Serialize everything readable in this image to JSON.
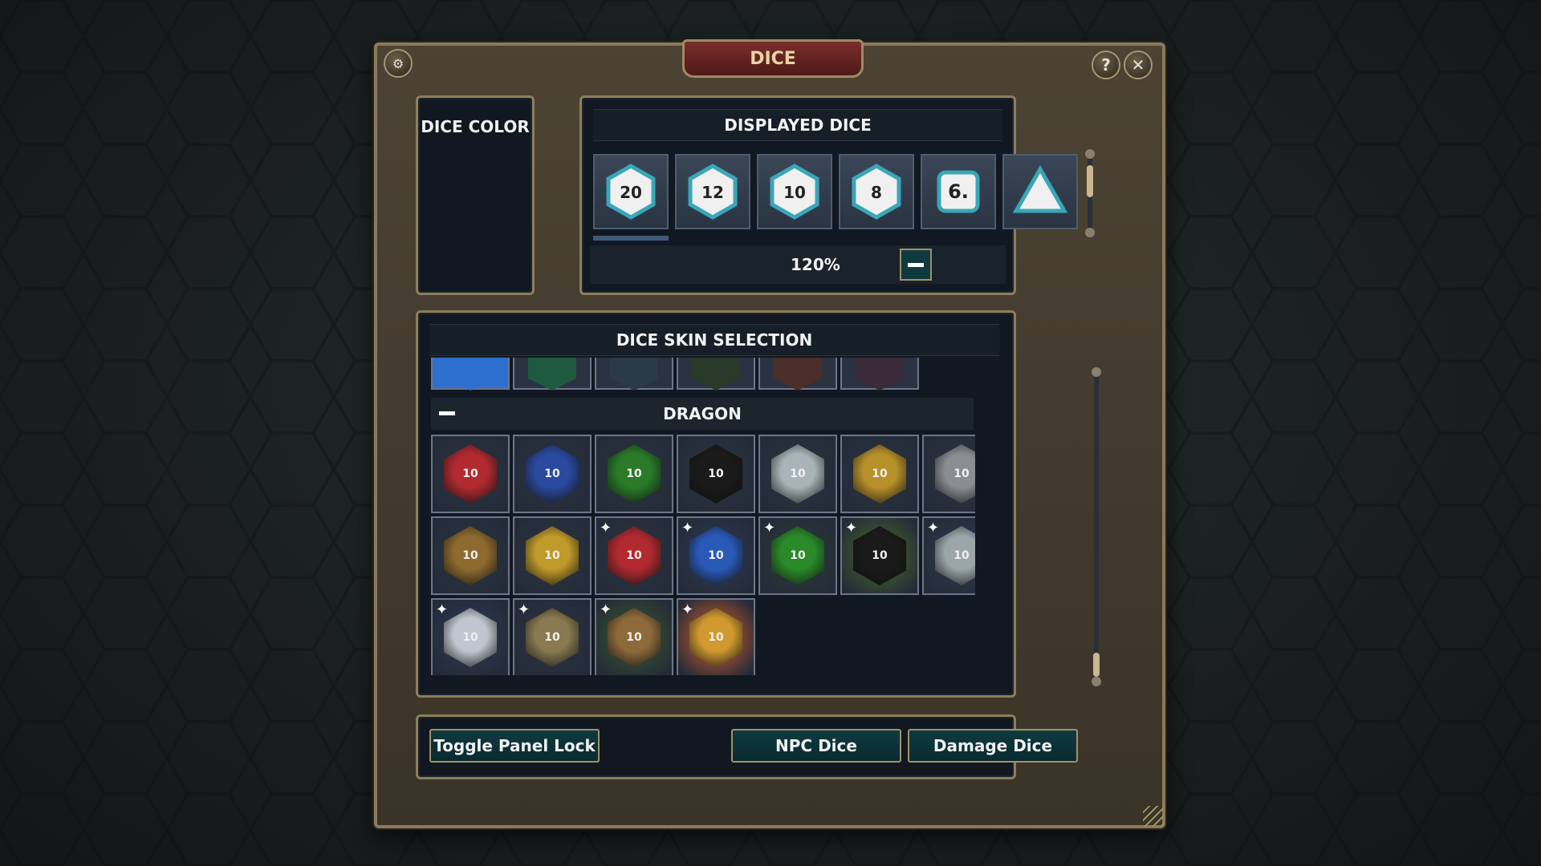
{
  "window": {
    "title": "DICE"
  },
  "dice_color": {
    "heading": "DICE COLOR"
  },
  "displayed_dice": {
    "heading": "DISPLAYED DICE",
    "dice": [
      {
        "label": "20",
        "icon": "d20-icon"
      },
      {
        "label": "12",
        "icon": "d12-icon"
      },
      {
        "label": "10",
        "icon": "d10-icon"
      },
      {
        "label": "8",
        "icon": "d8-icon"
      },
      {
        "label": "6.",
        "icon": "d6-icon"
      },
      {
        "label": "",
        "icon": "d4-icon"
      }
    ],
    "scale": "120%"
  },
  "skin_selection": {
    "heading": "DICE SKIN SELECTION",
    "group": "DRAGON",
    "top_row_colors": [
      "#2f6fd0",
      "#1f5a40",
      "#2a3a48",
      "#2a3a2a",
      "#4a2e2a",
      "#3a2a3a"
    ],
    "dragon_dice": [
      {
        "color": "#b02a30",
        "effect": false,
        "bg": "#2b3242",
        "label": "10"
      },
      {
        "color": "#2a4aa0",
        "effect": false,
        "bg": "#2b3242",
        "label": "10"
      },
      {
        "color": "#2a7a2a",
        "effect": false,
        "bg": "#2b3242",
        "label": "10"
      },
      {
        "color": "#1a1a1a",
        "effect": false,
        "bg": "#2b3242",
        "label": "10"
      },
      {
        "color": "#a8b4b8",
        "effect": false,
        "bg": "#2b3242",
        "label": "10"
      },
      {
        "color": "#b8902a",
        "effect": false,
        "bg": "#2b3242",
        "label": "10"
      },
      {
        "color": "#8a8e94",
        "effect": false,
        "bg": "#2b3242",
        "label": "10"
      },
      {
        "color": "#6e6240",
        "effect": false,
        "bg": "#2b3242",
        "label": "10"
      },
      {
        "color": "#8e6a2e",
        "effect": false,
        "bg": "#2b3242",
        "label": "10"
      },
      {
        "color": "#c09a2a",
        "effect": false,
        "bg": "#2b3242",
        "label": "10"
      },
      {
        "color": "#b02a30",
        "effect": true,
        "bg": "#2b3242",
        "label": "10"
      },
      {
        "color": "#2a5ab8",
        "effect": true,
        "bg": "#2b3a55",
        "label": "10"
      },
      {
        "color": "#2a8a2a",
        "effect": true,
        "bg": "#2b3a38",
        "label": "10"
      },
      {
        "color": "#1a1a1a",
        "effect": true,
        "bg": "#4a6a2a",
        "label": "10"
      },
      {
        "color": "#9aa6aa",
        "effect": true,
        "bg": "#2b3a4a",
        "label": "10"
      },
      {
        "color": "#c0902a",
        "effect": true,
        "bg": "#3a3a3a",
        "label": "10"
      },
      {
        "color": "#c0c6d0",
        "effect": true,
        "bg": "#2b3a55",
        "label": "10"
      },
      {
        "color": "#8a7a50",
        "effect": true,
        "bg": "#2b3242",
        "label": "10"
      },
      {
        "color": "#8e6a3a",
        "effect": true,
        "bg": "#3a5a2a",
        "label": "10"
      },
      {
        "color": "#d09a30",
        "effect": true,
        "bg": "#e0602a",
        "label": "10"
      }
    ]
  },
  "buttons": {
    "toggle_lock": "Toggle Panel Lock",
    "npc_dice": "NPC Dice",
    "damage_dice": "Damage Dice"
  },
  "controls": {
    "help": "?",
    "close": "✕"
  }
}
